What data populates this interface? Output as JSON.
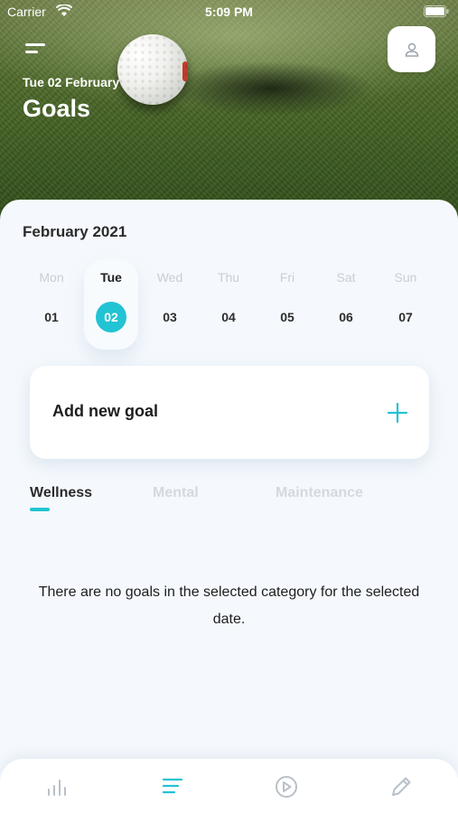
{
  "status_bar": {
    "carrier": "Carrier",
    "time": "5:09 PM"
  },
  "header": {
    "date": "Tue 02 February",
    "title": "Goals",
    "menu_icon": "menu-icon",
    "profile_icon": "user-icon"
  },
  "calendar": {
    "month": "February 2021",
    "days": [
      {
        "name": "Mon",
        "num": "01"
      },
      {
        "name": "Tue",
        "num": "02"
      },
      {
        "name": "Wed",
        "num": "03"
      },
      {
        "name": "Thu",
        "num": "04"
      },
      {
        "name": "Fri",
        "num": "05"
      },
      {
        "name": "Sat",
        "num": "06"
      },
      {
        "name": "Sun",
        "num": "07"
      }
    ],
    "selected_index": 1
  },
  "add_goal": {
    "label": "Add new goal",
    "icon": "plus-icon"
  },
  "tabs": [
    {
      "label": "Wellness",
      "active": true
    },
    {
      "label": "Mental",
      "active": false
    },
    {
      "label": "Maintenance",
      "active": false
    }
  ],
  "empty_message": "There are no goals in the selected category for the selected date.",
  "bottom_nav": [
    {
      "icon": "bar-chart-icon",
      "active": false
    },
    {
      "icon": "list-icon",
      "active": true
    },
    {
      "icon": "play-circle-icon",
      "active": false
    },
    {
      "icon": "pencil-icon",
      "active": false
    }
  ],
  "colors": {
    "accent": "#22c3d3",
    "inactive": "#c8ced6",
    "text": "#1e1e1e"
  }
}
